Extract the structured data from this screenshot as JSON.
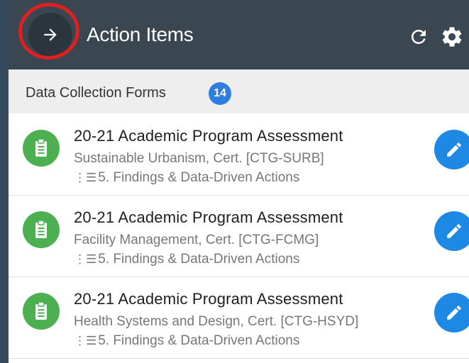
{
  "header": {
    "title": "Action Items",
    "back_icon": "arrow-right-icon",
    "refresh_icon": "refresh-icon",
    "settings_icon": "gear-icon"
  },
  "section": {
    "title": "Data Collection Forms",
    "count": "14"
  },
  "items": [
    {
      "title": "20-21 Academic Program Assessment",
      "subtitle": "Sustainable Urbanism, Cert. [CTG-SURB]",
      "step": "5. Findings & Data-Driven Actions"
    },
    {
      "title": "20-21 Academic Program Assessment",
      "subtitle": "Facility Management, Cert. [CTG-FCMG]",
      "step": "5. Findings & Data-Driven Actions"
    },
    {
      "title": "20-21 Academic Program Assessment",
      "subtitle": "Health Systems and Design, Cert. [CTG-HSYD]",
      "step": "5. Findings & Data-Driven Actions"
    }
  ],
  "colors": {
    "header_bg": "#3a4650",
    "accent_blue": "#1e88e5",
    "badge_blue": "#2f7de1",
    "form_icon_green": "#4caf50",
    "annotation_red": "#e02020"
  }
}
